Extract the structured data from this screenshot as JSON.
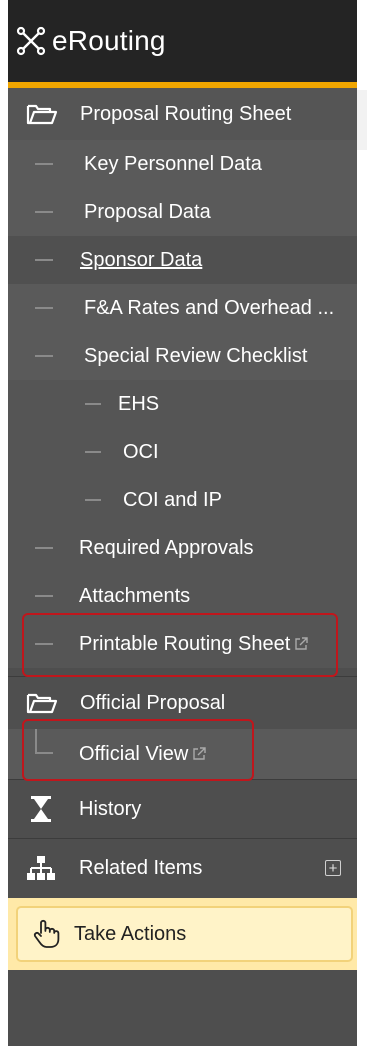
{
  "header": {
    "title": "eRouting"
  },
  "nav": {
    "proposal_routing_sheet": "Proposal Routing Sheet",
    "key_personnel": "Key Personnel Data",
    "proposal_data": "Proposal Data",
    "sponsor_data": " Sponsor Data",
    "fa_rates": "F&A Rates and Overhead ...",
    "special_review": "Special Review Checklist",
    "ehs": "EHS",
    "oci": "OCI",
    "coi_ip": "COI and IP",
    "required_approvals": "Required Approvals",
    "attachments": "Attachments",
    "printable_routing_sheet": "Printable Routing Sheet",
    "official_proposal": "Official Proposal",
    "official_view": "Official View",
    "history": "History",
    "related_items": "Related Items",
    "take_actions": "Take Actions"
  },
  "icons": {
    "logo": "network-icon",
    "folder": "folder-open-icon",
    "history": "hourglass-icon",
    "related": "sitemap-icon",
    "take_actions": "hand-pointer-icon",
    "external": "external-link-icon",
    "expand": "plus-square-icon"
  },
  "colors": {
    "accent": "#f0a500",
    "highlight": "#c0161c",
    "sidebar": "#4e4e4e",
    "header": "#242424"
  }
}
